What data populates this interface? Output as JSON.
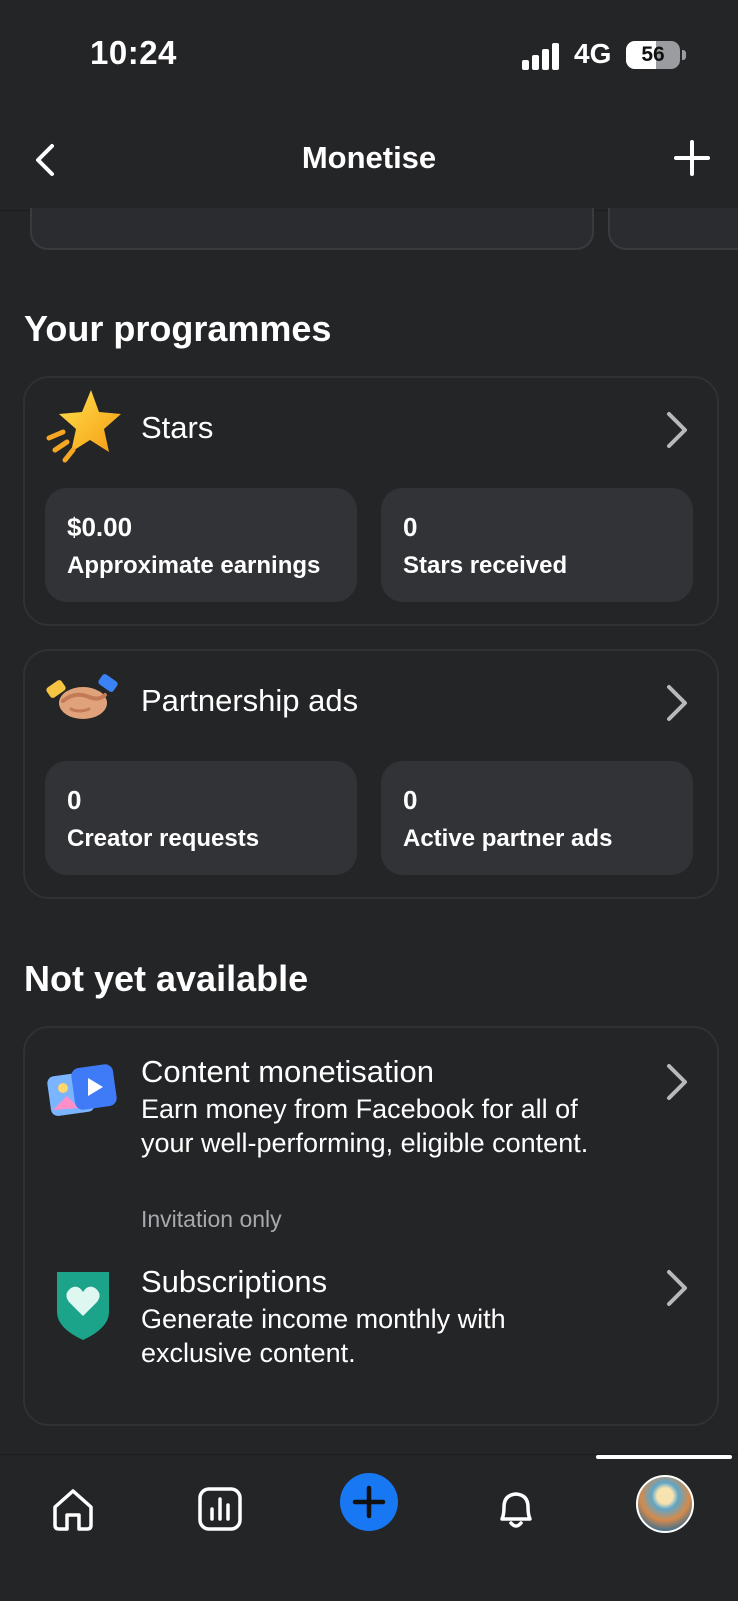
{
  "status": {
    "time": "10:24",
    "network": "4G",
    "battery": "56",
    "battery_level": 0.56
  },
  "header": {
    "title": "Monetise"
  },
  "sections": {
    "programmes_title": "Your programmes",
    "not_available_title": "Not yet available"
  },
  "programmes": [
    {
      "name": "Stars",
      "icon": "star-icon",
      "stats": [
        {
          "value": "$0.00",
          "label": "Approximate earnings"
        },
        {
          "value": "0",
          "label": "Stars received"
        }
      ]
    },
    {
      "name": "Partnership ads",
      "icon": "handshake-icon",
      "stats": [
        {
          "value": "0",
          "label": "Creator requests"
        },
        {
          "value": "0",
          "label": "Active partner ads"
        }
      ]
    }
  ],
  "not_available": [
    {
      "title": "Content monetisation",
      "icon": "content-media-icon",
      "description": "Earn money from Facebook for all of your well-performing, eligible content.",
      "note": "Invitation only"
    },
    {
      "title": "Subscriptions",
      "icon": "subscription-shield-icon",
      "description": "Generate income monthly with exclusive content."
    }
  ],
  "bottom_nav": [
    "home-icon",
    "insights-icon",
    "create-icon",
    "notifications-icon",
    "profile-avatar"
  ],
  "colors": {
    "background": "#242527",
    "card": "#323336",
    "accent": "#1877f2"
  }
}
